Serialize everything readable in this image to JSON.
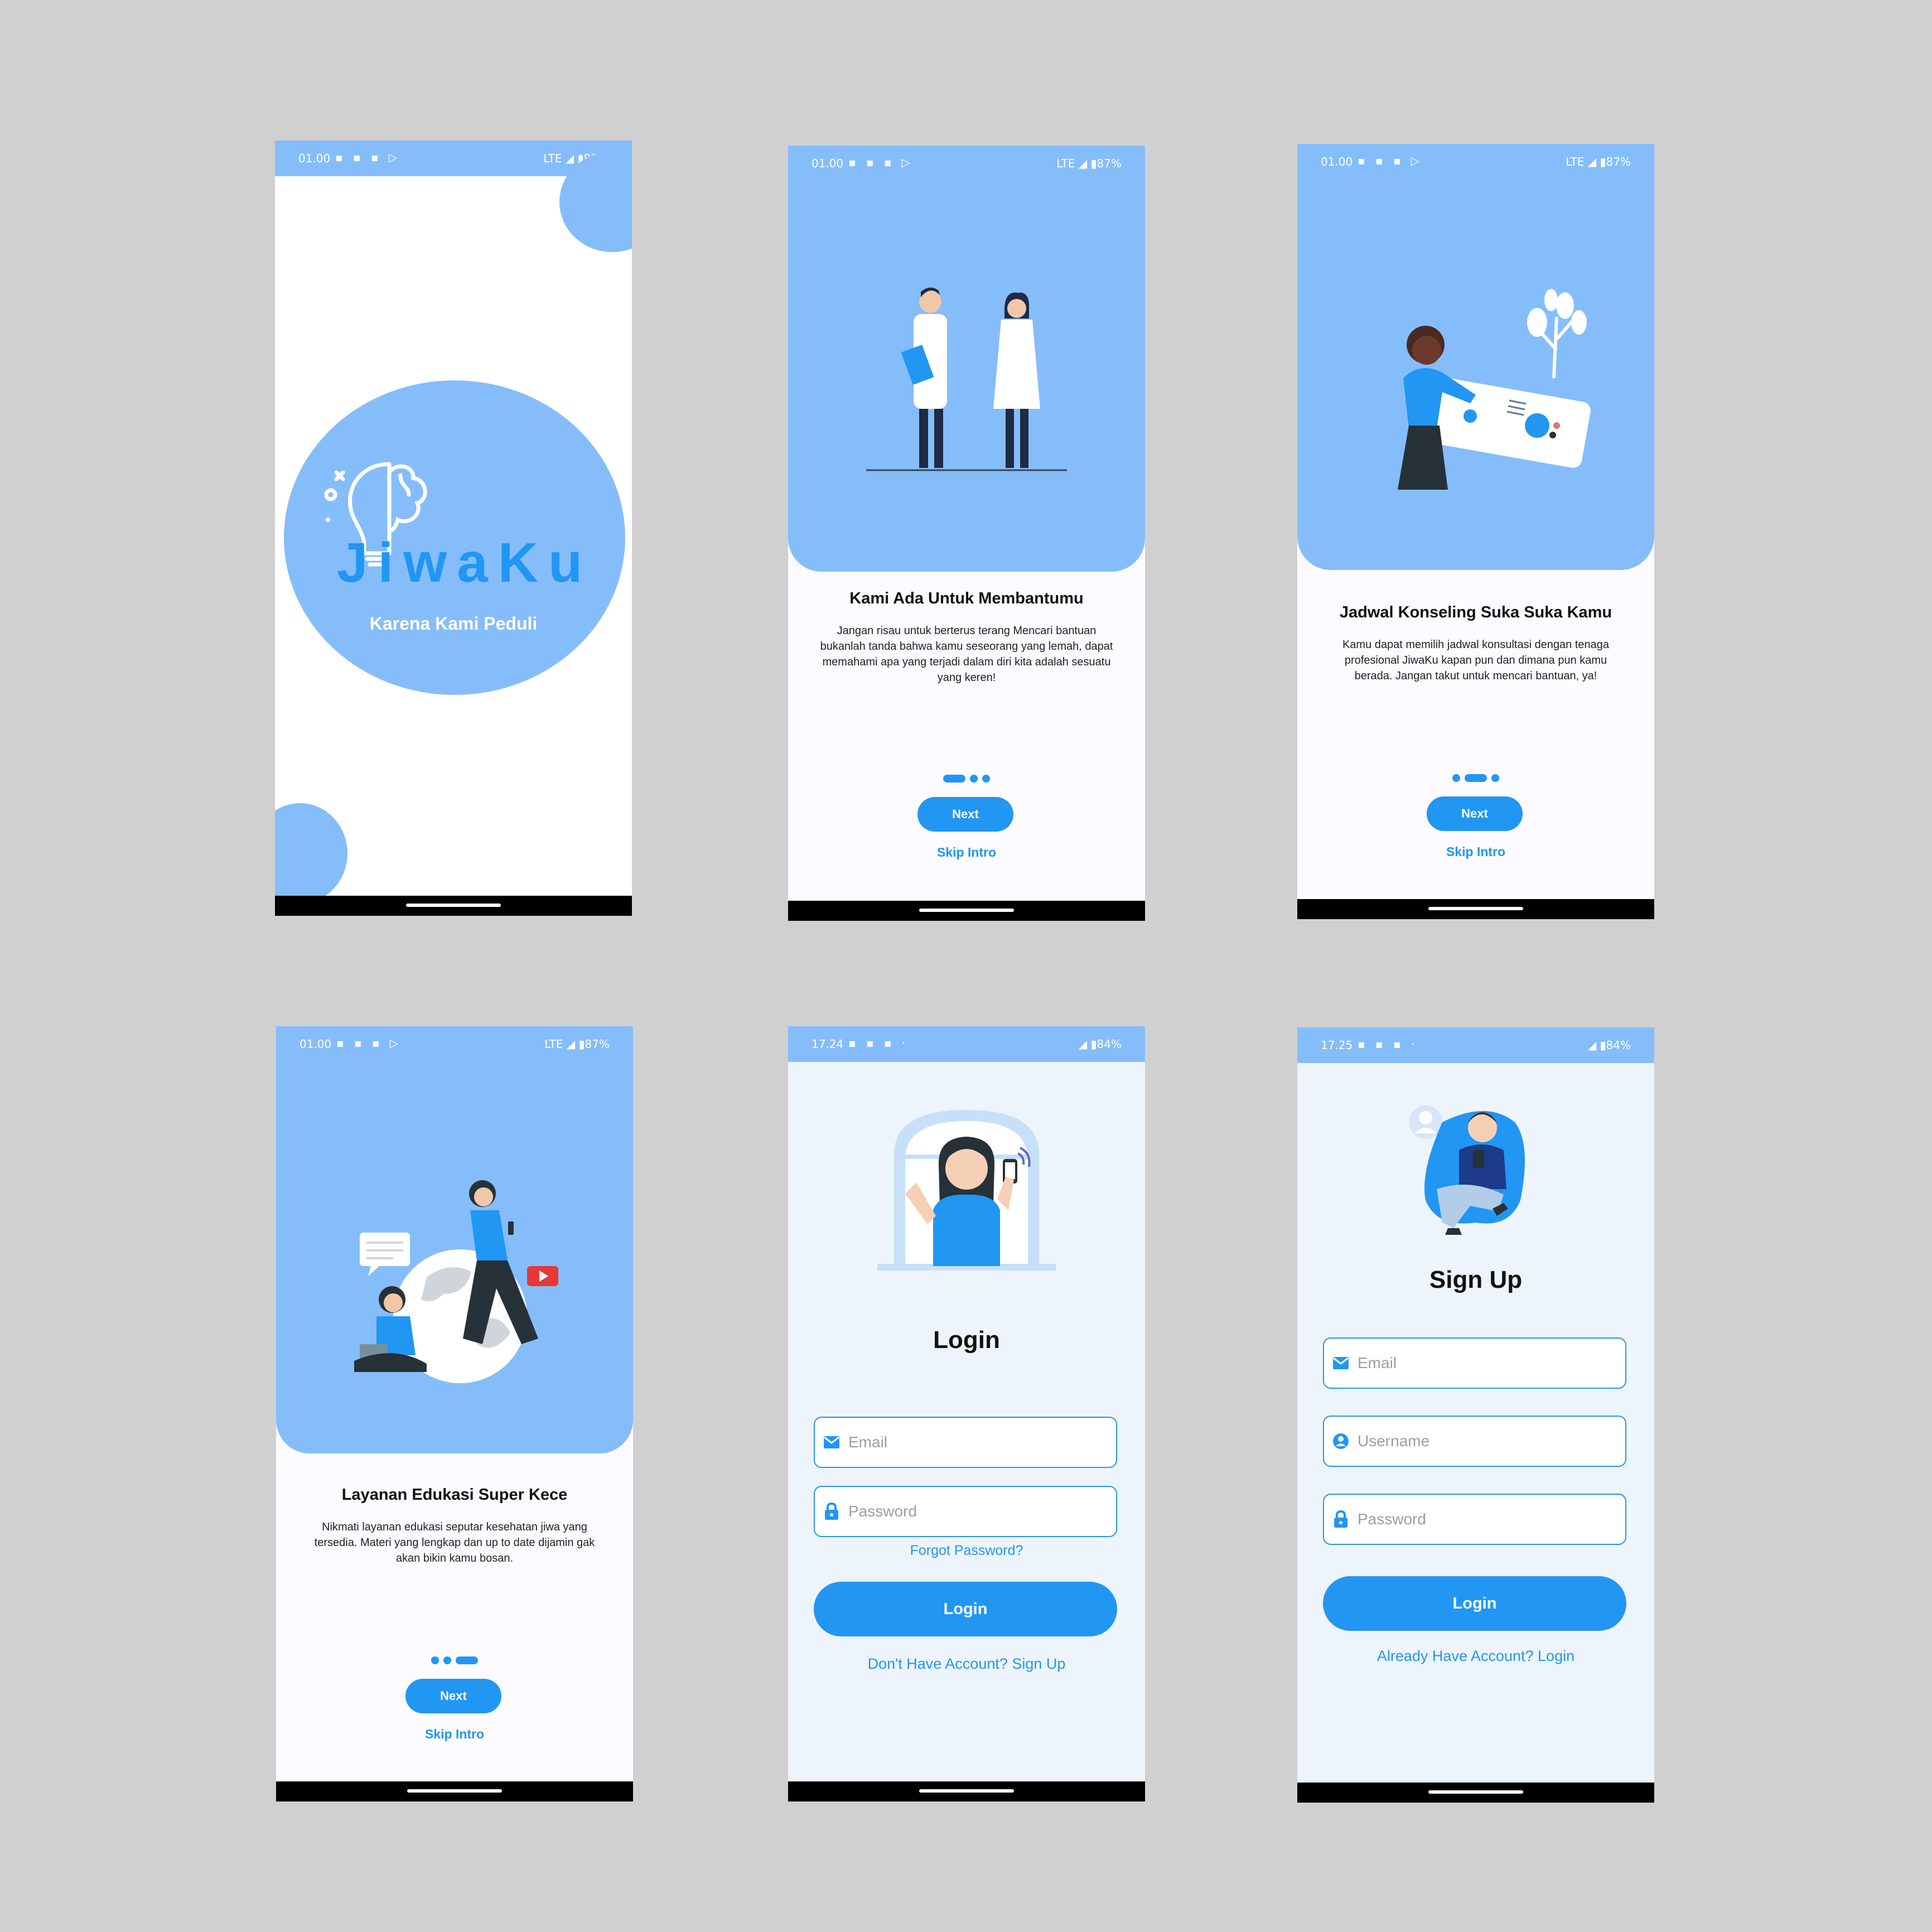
{
  "colors": {
    "background": "#d0d0d0",
    "primary": "#2196f3",
    "hero": "#85bdfb"
  },
  "status_intro": {
    "time": "01.00",
    "right": "LTE ◢ ▮87%"
  },
  "status_login": {
    "time": "17.24",
    "right": "◢ ▮84%"
  },
  "status_signup": {
    "time": "17.25",
    "right": "◢ ▮84%"
  },
  "splash": {
    "logo_text": "JiwaKu",
    "tagline": "Karena Kami Peduli"
  },
  "slides": [
    {
      "title": "Kami Ada Untuk Membantumu",
      "desc": "Jangan risau untuk berterus terang Mencari bantuan bukanlah tanda bahwa kamu seseorang yang lemah, dapat memahami apa yang terjadi dalam diri kita adalah sesuatu yang keren!",
      "next": "Next",
      "skip": "Skip Intro"
    },
    {
      "title": "Jadwal Konseling Suka Suka Kamu",
      "desc": "Kamu dapat memilih jadwal konsultasi dengan tenaga profesional JiwaKu kapan pun dan dimana pun kamu berada. Jangan takut untuk mencari bantuan, ya!",
      "next": "Next",
      "skip": "Skip Intro"
    },
    {
      "title": "Layanan Edukasi Super Kece",
      "desc": "Nikmati layanan edukasi seputar kesehatan jiwa yang tersedia. Materi yang lengkap dan up to date dijamin gak akan bikin kamu bosan.",
      "next": "Next",
      "skip": "Skip Intro"
    }
  ],
  "login": {
    "title": "Login",
    "email_placeholder": "Email",
    "password_placeholder": "Password",
    "forgot": "Forgot Password?",
    "button": "Login",
    "signup_link": "Don't Have Account? Sign Up"
  },
  "signup": {
    "title": "Sign Up",
    "email_placeholder": "Email",
    "username_placeholder": "Username",
    "password_placeholder": "Password",
    "button": "Login",
    "login_link": "Already Have Account? Login"
  }
}
